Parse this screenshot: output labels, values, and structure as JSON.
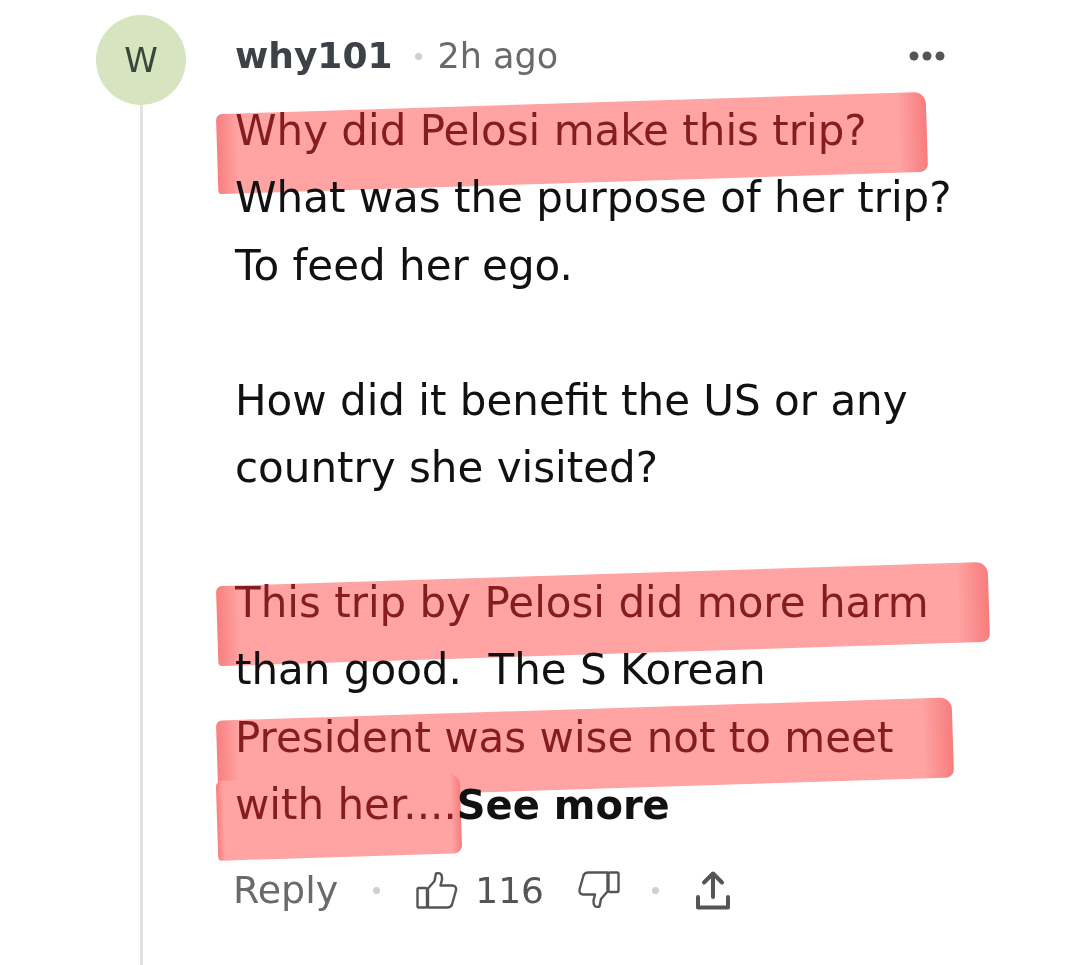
{
  "comment": {
    "avatar": {
      "initial": "W"
    },
    "author": "why101",
    "time": "2h ago",
    "paragraphs": [
      {
        "lines": [
          {
            "text": "Why did Pelosi make this trip?",
            "highlighted": true
          },
          {
            "text": "What was the purpose of her trip?",
            "highlighted": false
          },
          {
            "text": "To feed her ego.",
            "highlighted": false
          }
        ]
      },
      {
        "lines": [
          {
            "text": "How did it benefit the US or any",
            "highlighted": false
          },
          {
            "text": "country she visited?",
            "highlighted": false
          }
        ]
      },
      {
        "lines": [
          {
            "text": "This trip by Pelosi did more harm",
            "highlighted": true
          },
          {
            "text": "than good.  The S Korean",
            "highlighted": false
          },
          {
            "text": "President was wise not to meet",
            "highlighted": true
          },
          {
            "text": "with her....",
            "highlighted": true
          }
        ]
      }
    ],
    "see_more": "See more",
    "actions": {
      "reply": "Reply",
      "likes": "116"
    }
  }
}
